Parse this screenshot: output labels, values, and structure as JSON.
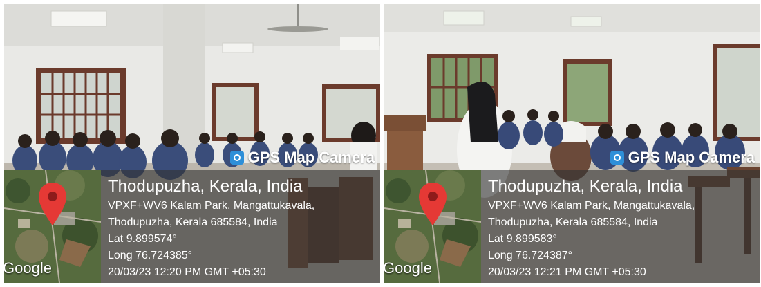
{
  "panels": [
    {
      "app_name": "GPS Map Camera",
      "location_title": "Thodupuzha, Kerala, India",
      "address_line1": "VPXF+WV6 Kalam Park, Mangattukavala,",
      "address_line2": "Thodupuzha, Kerala 685584, India",
      "lat": "Lat 9.899574°",
      "long": "Long 76.724385°",
      "datetime": "20/03/23 12:20 PM GMT +05:30",
      "map_logo": "Google",
      "icons": {
        "camera": "gps-map-camera-icon",
        "pin": "map-pin-icon"
      }
    },
    {
      "app_name": "GPS Map Camera",
      "location_title": "Thodupuzha, Kerala, India",
      "address_line1": "VPXF+WV6 Kalam Park, Mangattukavala,",
      "address_line2": "Thodupuzha, Kerala 685584, India",
      "lat": "Lat 9.899583°",
      "long": "Long 76.724387°",
      "datetime": "20/03/23 12:21 PM GMT +05:30",
      "map_logo": "Google",
      "icons": {
        "camera": "gps-map-camera-icon",
        "pin": "map-pin-icon"
      }
    }
  ],
  "colors": {
    "pin": "#e53935",
    "overlay": "#323232",
    "camera_icon": "#2e8fd8"
  }
}
